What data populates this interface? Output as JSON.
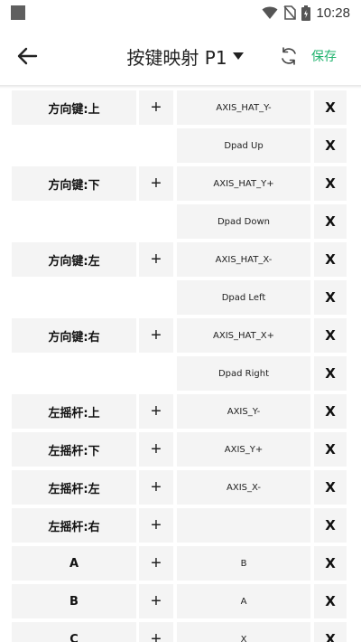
{
  "status_bar": {
    "time": "10:28"
  },
  "header": {
    "title": "按键映射 P1",
    "save_label": "保存"
  },
  "labels": {
    "add": "+",
    "delete": "X"
  },
  "rows": [
    {
      "key": "方向键:上",
      "value": "AXIS_HAT_Y-"
    },
    {
      "key": "",
      "value": "Dpad Up"
    },
    {
      "key": "方向键:下",
      "value": "AXIS_HAT_Y+"
    },
    {
      "key": "",
      "value": "Dpad Down"
    },
    {
      "key": "方向键:左",
      "value": "AXIS_HAT_X-"
    },
    {
      "key": "",
      "value": "Dpad Left"
    },
    {
      "key": "方向键:右",
      "value": "AXIS_HAT_X+"
    },
    {
      "key": "",
      "value": "Dpad Right"
    },
    {
      "key": "左摇杆:上",
      "value": "AXIS_Y-"
    },
    {
      "key": "左摇杆:下",
      "value": "AXIS_Y+"
    },
    {
      "key": "左摇杆:左",
      "value": "AXIS_X-"
    },
    {
      "key": "左摇杆:右",
      "value": ""
    },
    {
      "key": "A",
      "value": "B"
    },
    {
      "key": "B",
      "value": "A"
    },
    {
      "key": "C",
      "value": "X"
    }
  ]
}
